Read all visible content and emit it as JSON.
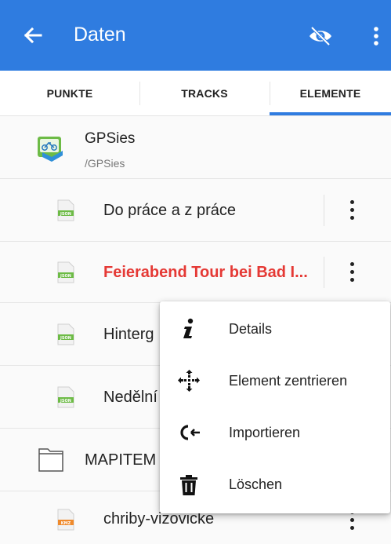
{
  "appbar": {
    "title": "Daten",
    "back_icon": "arrow-left-icon",
    "visibility_icon": "eye-off-icon",
    "more_icon": "more-vert-icon",
    "color": "#2f7ce0"
  },
  "tabs": [
    {
      "label": "PUNKTE",
      "active": false
    },
    {
      "label": "TRACKS",
      "active": false
    },
    {
      "label": "ELEMENTE",
      "active": true
    }
  ],
  "folder_gpsies": {
    "name": "GPSies",
    "path": "/GPSies",
    "icon": "gpsies-logo-icon"
  },
  "items": [
    {
      "name": "Do práce a z práce",
      "type": "JSON",
      "highlighted": false
    },
    {
      "name": "Feierabend Tour bei Bad I...",
      "type": "JSON",
      "highlighted": true,
      "highlight_color": "#e53935"
    },
    {
      "name": "Hinterg",
      "type": "JSON",
      "highlighted": false
    },
    {
      "name": "Nedělní",
      "type": "JSON",
      "highlighted": false
    }
  ],
  "folder_mapitem": {
    "name": "MAPITEM",
    "icon": "folder-icon"
  },
  "kmz_item": {
    "name": "chriby-vizovicke",
    "type": "KMZ"
  },
  "context_menu": [
    {
      "label": "Details",
      "icon": "info-icon"
    },
    {
      "label": "Element zentrieren",
      "icon": "center-arrows-icon"
    },
    {
      "label": "Importieren",
      "icon": "import-icon"
    },
    {
      "label": "Löschen",
      "icon": "trash-icon"
    }
  ]
}
